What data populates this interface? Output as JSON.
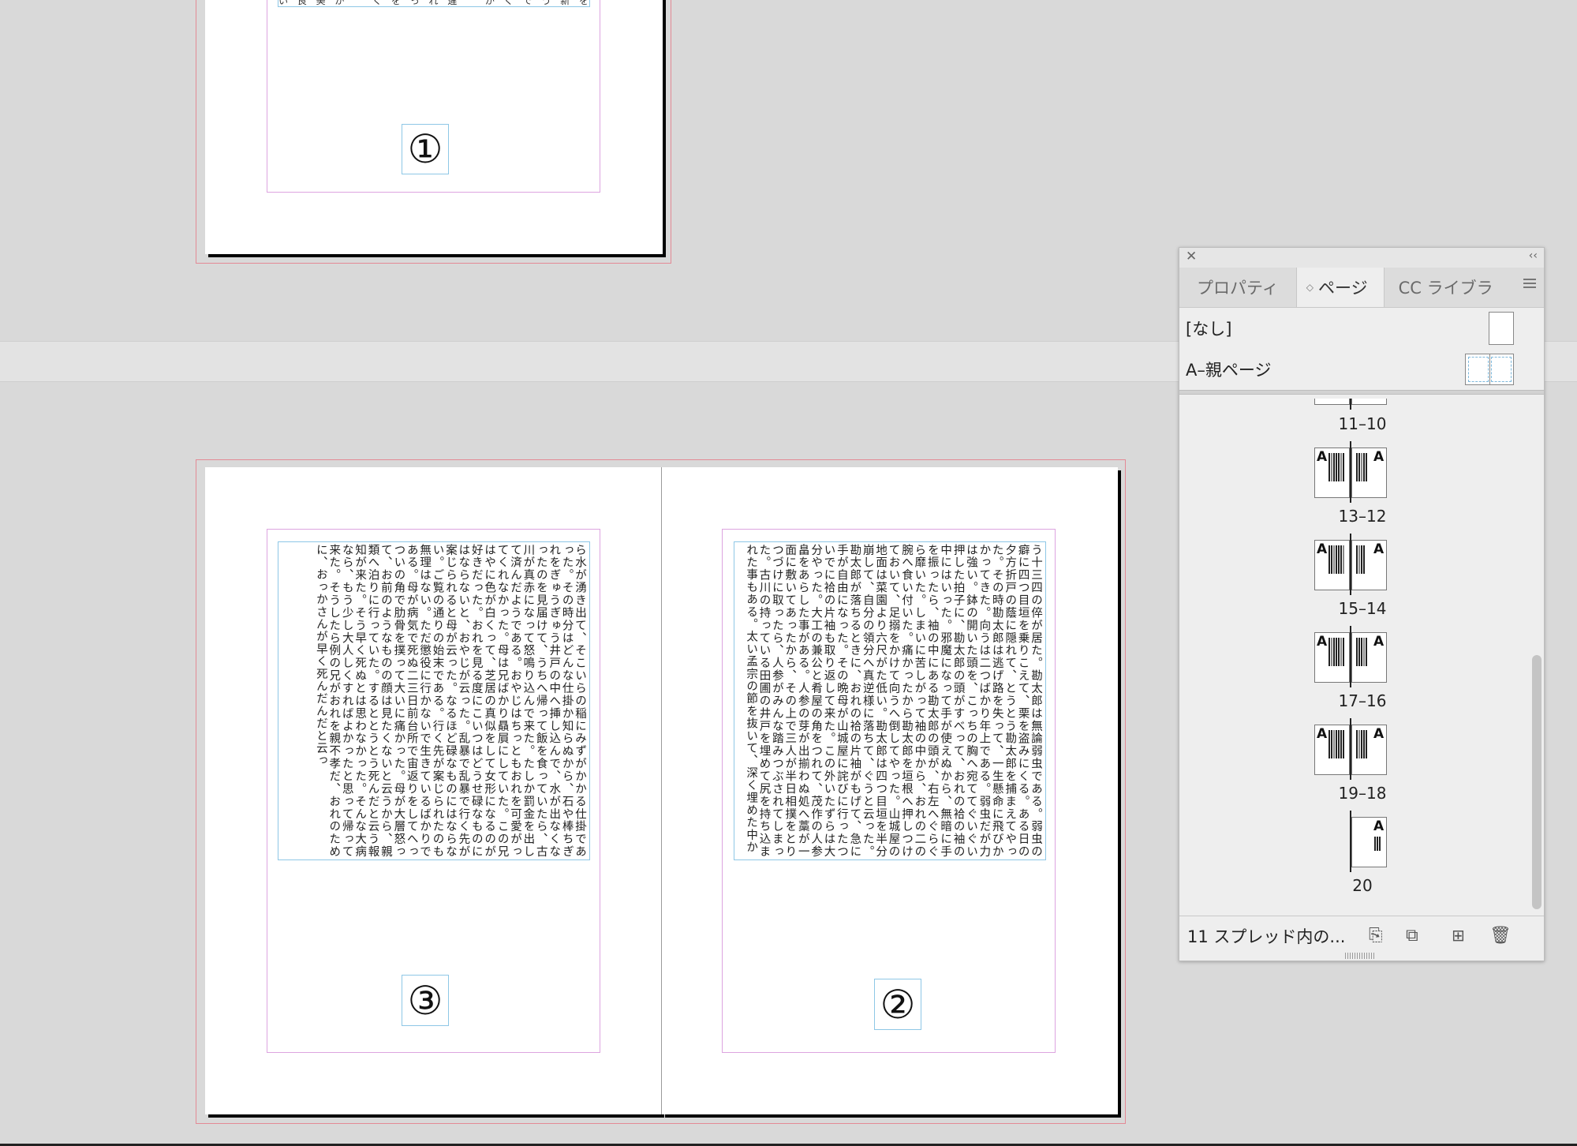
{
  "top_spread": {
    "top_text": "い 良 美 が 　 く を っ れ 違 　 が く で う 新 を 分",
    "folio": "①"
  },
  "bottom_spread": {
    "left_page": {
      "text": "ら水が湧き出て、そこいらの稲にみずがかかる仕掛であった。その時分はどんな仕掛か知らぬから、石や棒ちぎれをぎゅうぎゅう井戸の中へ挿し込んで、水が出なくなったのを見届けて、うちへ帰って飯を食っていたら、古川が真赤になって怒鳴り込んで来た。たしか罰金を出して済んだようである。おやじはちっともおれを可愛がってくれなかった。母は兄ばかり贔屓にしていた。この兄はやに色が白くって、芝居の真似をして女形になるのが好きだった。おれを見る度にこいつはどうせ碌なものにはならないと、おやじが云った。乱暴で乱暴で行く先が案じられると母が云った。なるほど碌なものにはならない。ご覧の通りの始末である。行く先が案じられたのも無理はない。ただ懲役に行かないで生きているばかりである。母が病気で死ぬ二三日前台所で宙返りをしてへっついの角で肋骨を撲って大いに痛かった。母が大層怒って、お前のようなものの顔は見たくないと云うから、親類へ泊りに行っていた。するととうとう死んだと云う報知が来た。そう早く死ぬとは思わなかった。そんな大病なら、もう少し大人しくすればよかったと思って帰って来た。そうしたら例の兄がおれを親不孝だ、おれのために、おっかさんが早く死んだんだと云っ",
      "folio": "③"
    },
    "right_page": {
      "text": "う十三四の倅が居た。勘太郎は無論弱虫である。弱虫の癖に四つ目垣を乗りこえて、栗を盗みにくる。ある日の夕方折戸の蔭に隠れて、とうとう勘太郎を捕まえてやった。その時勘太郎は逃げ路を失って、一生懸命に飛びかかってきた。向うは二つばかり年上である。弱虫だが力は強い。鉢の開いた頭を、こっちの胸へ宛ててぐいぐい押した拍子に、勘太郎の頭がすべって、おれの袷の袖の中にはいった。邪魔になって手が使えぬから、無暗に手を振ったら、袖の中にある勘太郎の頭が、右左へぐらぐら靡いた。しまいに苦しがって袖の中から、おれの二の腕へ食い付いた。痛かったから勘太郎を垣根へ押しつけておいて、足搦をかけて向うへ倒してやった。山城屋の地面は菜園より六尺がた低い。勘太郎は四つ目垣を半分崩して、自分の領分へ真逆様に落ちて、ぐうと云った。勘太郎が落ちるときに、おれの袷の片袖がもげて、急に手が自由になった。その晩母が山城屋に詫びに行ったついでに袷の片袖も取り返して来た。この外いたずらは大分やった。大工の兼公と肴屋の角をつれて、茂作の人参畠をあらした事がある。人参の芽が出揃わぬ処へ藁が一面に敷いてあったから、その上で三人が半日相撲をとりつづけに取ったら、人参がみんな踏みつぶされてしまった。古川の持っている田圃の井戸を埋めて尻を持ち込まれた事もある。太い孟宗の節を抜いて、深く埋めた中か",
      "folio": "②"
    }
  },
  "panel": {
    "tabs": [
      "プロパティ",
      "ページ",
      "CC ライブラリ"
    ],
    "active_tab_sort_icon": "◇",
    "parent_pages": [
      {
        "label": "[なし]"
      },
      {
        "label": "A–親ページ"
      }
    ],
    "spreads": [
      {
        "label": "11–10"
      },
      {
        "label": "13–12"
      },
      {
        "label": "15–14"
      },
      {
        "label": "17–16"
      },
      {
        "label": "19–18"
      },
      {
        "label": "20"
      }
    ],
    "footer_text": "11 スプレッド内の...",
    "icons": [
      "close-icon",
      "collapse-icon",
      "menu-icon",
      "edit-page-size-icon",
      "page-options-icon",
      "new-page-icon",
      "delete-icon"
    ]
  }
}
